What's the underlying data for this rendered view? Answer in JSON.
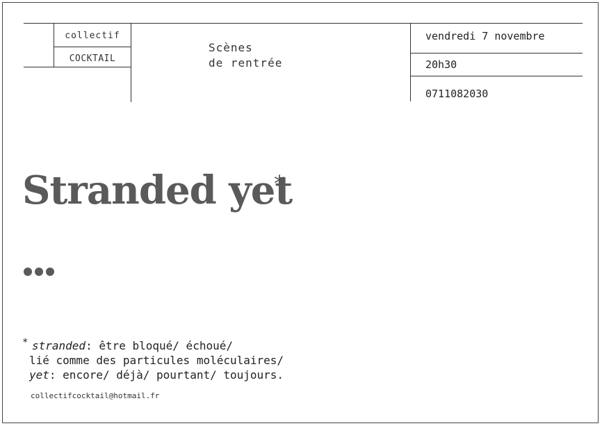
{
  "header": {
    "collectif_label": "collectif",
    "cocktail_label": "COCKTAIL",
    "event_line1": "Scènes",
    "event_line2": "de rentrée",
    "date": "vendredi 7 novembre",
    "time": "20h30",
    "phone": "0711082030"
  },
  "main": {
    "title": "Stranded yet",
    "title_marker": "*",
    "dots": [
      "•",
      "•",
      "•"
    ]
  },
  "footnote": {
    "marker": "*",
    "term1": "stranded",
    "line1_rest": ": être bloqué/ échoué/",
    "line2": "lié comme des particules moléculaires/",
    "term2": "yet",
    "line3_rest": ": encore/ déjà/ pourtant/ toujours."
  },
  "contact": {
    "email": "collectifcocktail@hotmail.fr"
  }
}
